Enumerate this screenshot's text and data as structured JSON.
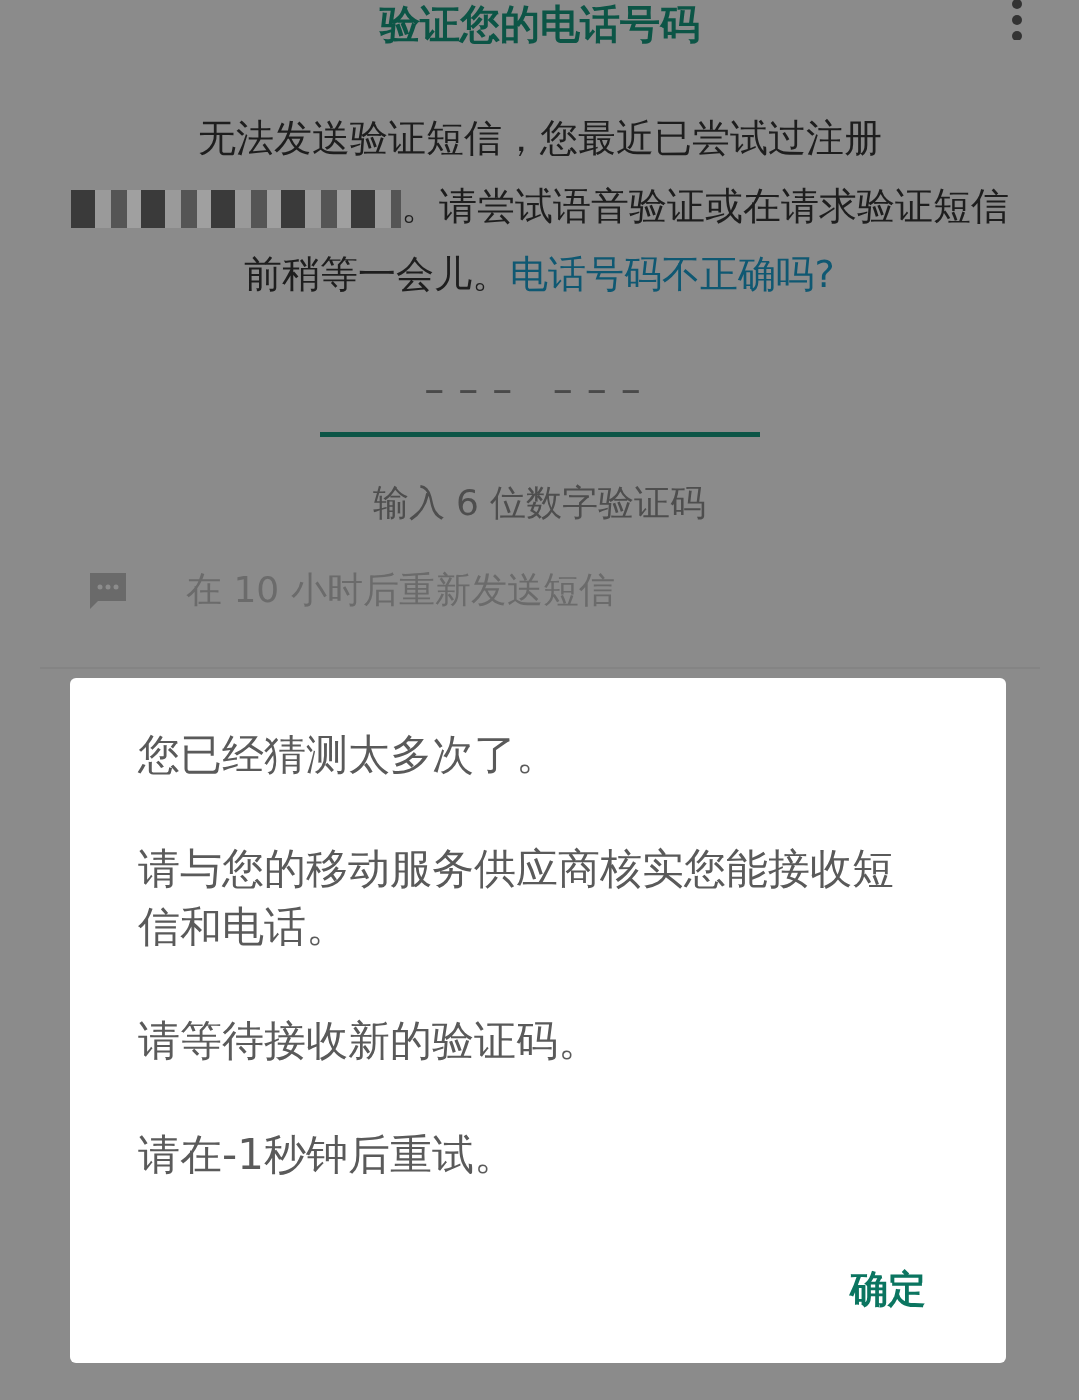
{
  "header": {
    "title": "验证您的电话号码"
  },
  "notice": {
    "text_before": "无法发送验证短信，您最近已尝试过注册",
    "redacted": true,
    "text_after": "。请尝试语音验证或在请求验证短信前稍等一会儿。",
    "link": "电话号码不正确吗?"
  },
  "code_field": {
    "placeholder": "––– –––",
    "hint": "输入 6 位数字验证码"
  },
  "resend": {
    "label": "在 10 小时后重新发送短信",
    "disabled": true
  },
  "dialog": {
    "messages": [
      "您已经猜测太多次了。",
      "请与您的移动服务供应商核实您能接收短信和电话。",
      "请等待接收新的验证码。",
      "请在-1秒钟后重试。"
    ],
    "button": "确定"
  }
}
